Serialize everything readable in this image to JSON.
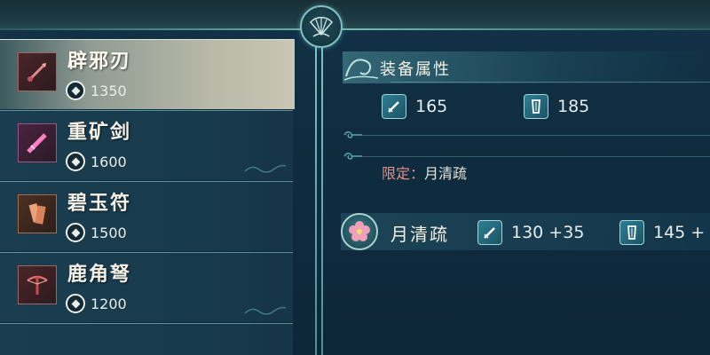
{
  "weapons": [
    {
      "name": "辟邪刃",
      "price": "1350",
      "icon": "blade-icon",
      "selected": true
    },
    {
      "name": "重矿剑",
      "price": "1600",
      "icon": "sword-icon",
      "selected": false
    },
    {
      "name": "碧玉符",
      "price": "1500",
      "icon": "talisman-icon",
      "selected": false
    },
    {
      "name": "鹿角弩",
      "price": "1200",
      "icon": "crossbow-icon",
      "selected": false
    }
  ],
  "panel": {
    "title": "装备属性",
    "attack": "165",
    "defense": "185",
    "limit_label": "限定：",
    "limit_value": "月清疏"
  },
  "character": {
    "name": "月清疏",
    "attack": "130 +35",
    "defense": "145 +"
  },
  "colors": {
    "accent": "#7dc3c4",
    "limit_label": "#e48f8a",
    "selected_row": "#b7b8a7"
  }
}
